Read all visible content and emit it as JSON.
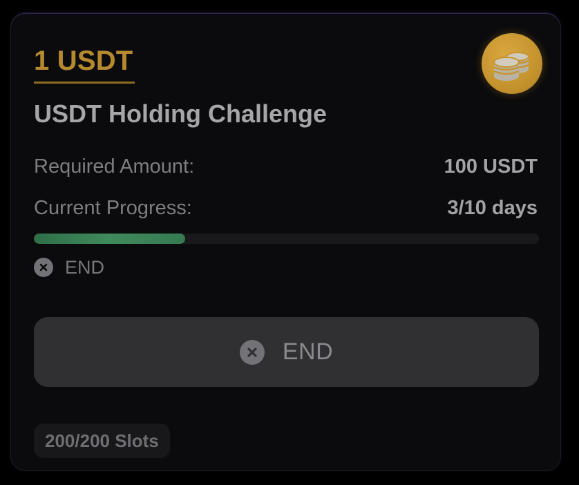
{
  "card": {
    "reward": "1 USDT",
    "coin_icon": "coins-icon",
    "title": "USDT Holding Challenge",
    "required_label": "Required Amount:",
    "required_value": "100 USDT",
    "progress_label": "Current Progress:",
    "progress_value": "3/10 days",
    "progress_fraction": 0.3,
    "status_icon": "close-circle-icon",
    "status_text": "END",
    "button_label": "END",
    "button_icon": "close-circle-icon",
    "slots": "200/200 Slots"
  },
  "colors": {
    "reward": "#b58a2e",
    "coin": "#c79530",
    "progress_fill": "#3f8a5c",
    "button_bg": "#303033"
  }
}
